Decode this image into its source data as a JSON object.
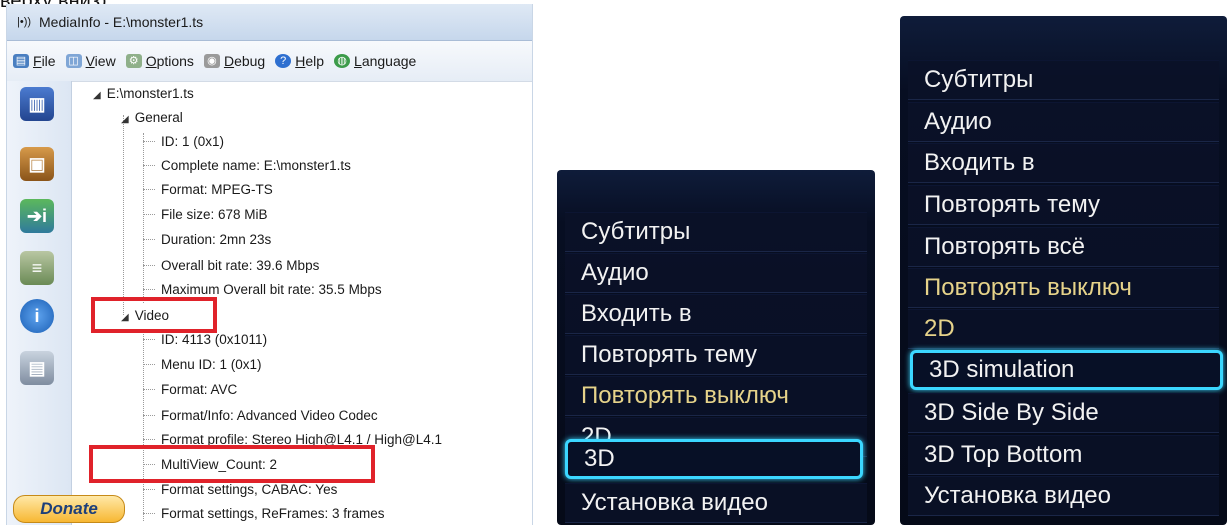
{
  "caption": "верху вниз).",
  "mediainfo": {
    "title": "MediaInfo - E:\\monster1.ts",
    "menu": [
      {
        "label": "File",
        "icon": "file-icon"
      },
      {
        "label": "View",
        "icon": "view-icon"
      },
      {
        "label": "Options",
        "icon": "options-icon"
      },
      {
        "label": "Debug",
        "icon": "debug-icon"
      },
      {
        "label": "Help",
        "icon": "help-icon"
      },
      {
        "label": "Language",
        "icon": "globe-icon"
      }
    ],
    "donate": "Donate",
    "tree": {
      "root": "E:\\monster1.ts",
      "general_label": "General",
      "general": [
        "ID: 1 (0x1)",
        "Complete name: E:\\monster1.ts",
        "Format: MPEG-TS",
        "File size: 678 MiB",
        "Duration: 2mn 23s",
        "Overall bit rate: 39.6 Mbps",
        "Maximum Overall bit rate: 35.5 Mbps"
      ],
      "video_label": "Video",
      "video": [
        "ID: 4113 (0x1011)",
        "Menu ID: 1 (0x1)",
        "Format: AVC",
        "Format/Info: Advanced Video Codec",
        "Format profile: Stereo High@L4.1 / High@L4.1",
        "MultiView_Count: 2",
        "Format settings, CABAC: Yes",
        "Format settings, ReFrames: 3 frames"
      ]
    },
    "accent_highlight": "#e0222a"
  },
  "osd_left": {
    "items": [
      "Субтитры",
      "Аудио",
      "Входить в",
      "Повторять тему",
      "Повторять выключ",
      "2D",
      "3D",
      "Установка видео"
    ],
    "selected": "3D"
  },
  "osd_right": {
    "items": [
      "Субтитры",
      "Аудио",
      "Входить в",
      "Повторять тему",
      "Повторять всё",
      "Повторять выключ",
      "2D",
      "3D simulation",
      "3D Side By Side",
      "3D Top Bottom",
      "Установка видео"
    ],
    "selected": "3D simulation"
  },
  "colors": {
    "osd_text": "#f2f2f2",
    "osd_dim_text": "#e6d38a",
    "osd_selection": "#3bd7ff"
  }
}
